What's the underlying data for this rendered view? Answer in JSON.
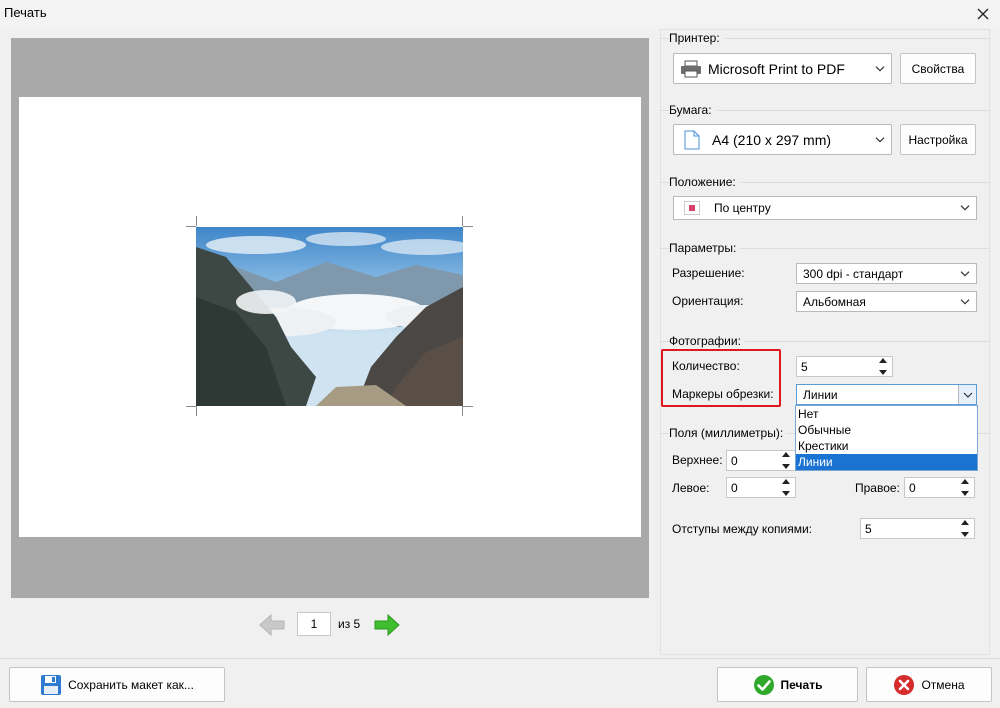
{
  "window": {
    "title": "Печать"
  },
  "preview": {
    "page_current": "1",
    "page_of": "из 5"
  },
  "printer": {
    "group_label": "Принтер:",
    "selected": "Microsoft Print to PDF",
    "properties_button": "Свойства"
  },
  "paper": {
    "group_label": "Бумага:",
    "selected": "A4 (210 x 297 mm)",
    "setup_button": "Настройка"
  },
  "position": {
    "group_label": "Положение:",
    "selected": "По центру"
  },
  "parameters": {
    "group_label": "Параметры:",
    "resolution_label": "Разрешение:",
    "resolution_value": "300 dpi - стандарт",
    "orientation_label": "Ориентация:",
    "orientation_value": "Альбомная"
  },
  "photos": {
    "group_label": "Фотографии:",
    "quantity_label": "Количество:",
    "quantity_value": "5",
    "crop_marks_label": "Маркеры обрезки:",
    "crop_marks_value": "Линии",
    "crop_marks_options": [
      "Нет",
      "Обычные",
      "Крестики",
      "Линии"
    ]
  },
  "margins": {
    "group_label": "Поля (миллиметры):",
    "top_label": "Верхнее:",
    "top_value": "0",
    "left_label": "Левое:",
    "left_value": "0",
    "right_label": "Правое:",
    "right_value": "0",
    "spacing_label": "Отступы между копиями:",
    "spacing_value": "5"
  },
  "actions": {
    "save_layout": "Сохранить макет как...",
    "print": "Печать",
    "cancel": "Отмена"
  },
  "colors": {
    "highlight": "#e0171c",
    "selection": "#1a73d1",
    "ok_green": "#2fa82c",
    "cancel_red": "#d62b2b"
  }
}
